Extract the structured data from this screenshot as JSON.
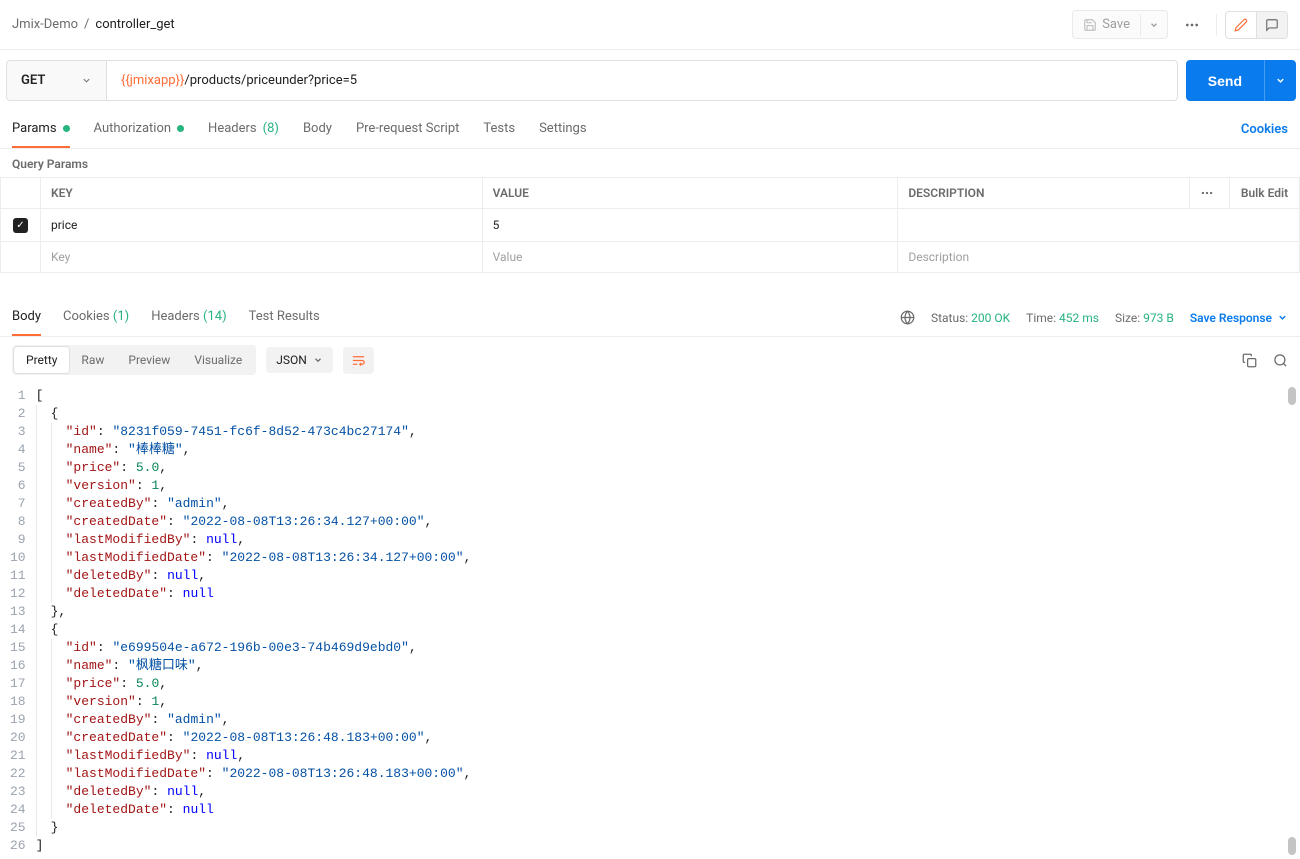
{
  "breadcrumb": {
    "parent": "Jmix-Demo",
    "current": "controller_get"
  },
  "topbar": {
    "save": "Save"
  },
  "request": {
    "method": "GET",
    "url_var": "{{jmixapp}}",
    "url_path": "/products/priceunder?price=5",
    "send": "Send"
  },
  "reqTabs": {
    "params": "Params",
    "auth": "Authorization",
    "headers": "Headers",
    "headers_count": "(8)",
    "body": "Body",
    "prereq": "Pre-request Script",
    "tests": "Tests",
    "settings": "Settings",
    "cookies": "Cookies"
  },
  "queryParams": {
    "label": "Query Params",
    "headers": {
      "key": "KEY",
      "value": "VALUE",
      "desc": "DESCRIPTION",
      "bulk": "Bulk Edit"
    },
    "rows": [
      {
        "checked": true,
        "key": "price",
        "value": "5",
        "desc": ""
      }
    ],
    "placeholders": {
      "key": "Key",
      "value": "Value",
      "desc": "Description"
    }
  },
  "respTabs": {
    "body": "Body",
    "cookies": "Cookies",
    "cookies_count": "(1)",
    "headers": "Headers",
    "headers_count": "(14)",
    "test": "Test Results"
  },
  "respMeta": {
    "status_l": "Status:",
    "status_v": "200 OK",
    "time_l": "Time:",
    "time_v": "452 ms",
    "size_l": "Size:",
    "size_v": "973 B",
    "save": "Save Response"
  },
  "bodyToolbar": {
    "pretty": "Pretty",
    "raw": "Raw",
    "preview": "Preview",
    "visualize": "Visualize",
    "format": "JSON"
  },
  "responseBody": [
    {
      "id": "8231f059-7451-fc6f-8d52-473c4bc27174",
      "name": "棒棒糖",
      "price": 5.0,
      "version": 1,
      "createdBy": "admin",
      "createdDate": "2022-08-08T13:26:34.127+00:00",
      "lastModifiedBy": null,
      "lastModifiedDate": "2022-08-08T13:26:34.127+00:00",
      "deletedBy": null,
      "deletedDate": null
    },
    {
      "id": "e699504e-a672-196b-00e3-74b469d9ebd0",
      "name": "枫糖口味",
      "price": 5.0,
      "version": 1,
      "createdBy": "admin",
      "createdDate": "2022-08-08T13:26:48.183+00:00",
      "lastModifiedBy": null,
      "lastModifiedDate": "2022-08-08T13:26:48.183+00:00",
      "deletedBy": null,
      "deletedDate": null
    }
  ]
}
